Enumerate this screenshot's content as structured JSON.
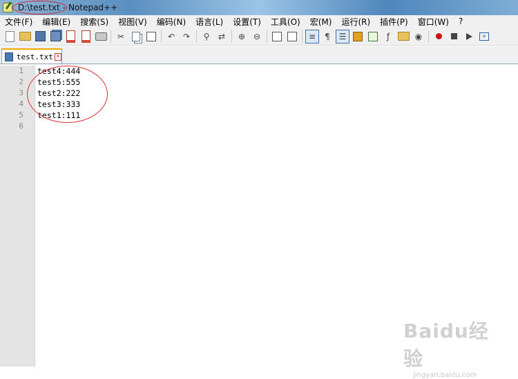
{
  "window": {
    "file": "D:\\test.txt",
    "separator": " - ",
    "app": "Notepad++"
  },
  "menu": [
    "文件(F)",
    "编辑(E)",
    "搜索(S)",
    "视图(V)",
    "编码(N)",
    "语言(L)",
    "设置(T)",
    "工具(O)",
    "宏(M)",
    "运行(R)",
    "插件(P)",
    "窗口(W)",
    "?"
  ],
  "toolbar": {
    "icons": [
      "new-file-icon",
      "open-file-icon",
      "save-icon",
      "save-all-icon",
      "close-icon",
      "close-all-icon",
      "print-icon",
      "cut-icon",
      "copy-icon",
      "paste-icon",
      "undo-icon",
      "redo-icon",
      "find-icon",
      "replace-icon",
      "zoom-in-icon",
      "zoom-out-icon",
      "sync-vertical-icon",
      "sync-horizontal-icon",
      "word-wrap-icon",
      "show-all-chars-icon",
      "indent-guide-icon",
      "user-lang-icon",
      "doc-map-icon",
      "function-list-icon",
      "folder-as-workspace-icon",
      "monitoring-icon",
      "record-macro-icon",
      "stop-record-icon",
      "play-macro-icon",
      "run-macro-multiple-icon"
    ],
    "pilcrow": "¶"
  },
  "tab": {
    "label": "test.txt"
  },
  "editor": {
    "lines": [
      {
        "num": "1",
        "text": "test4:444"
      },
      {
        "num": "2",
        "text": "test5:555"
      },
      {
        "num": "3",
        "text": "test2:222"
      },
      {
        "num": "4",
        "text": "test3:333"
      },
      {
        "num": "5",
        "text": "test1:111"
      },
      {
        "num": "6",
        "text": ""
      }
    ]
  },
  "watermark": {
    "logo": "Baidu经验",
    "url": "jingyan.baidu.com"
  },
  "colors": {
    "annotation": "#d93030",
    "current_line": "#e8e8ff",
    "tab_accent": "#f6a800"
  }
}
